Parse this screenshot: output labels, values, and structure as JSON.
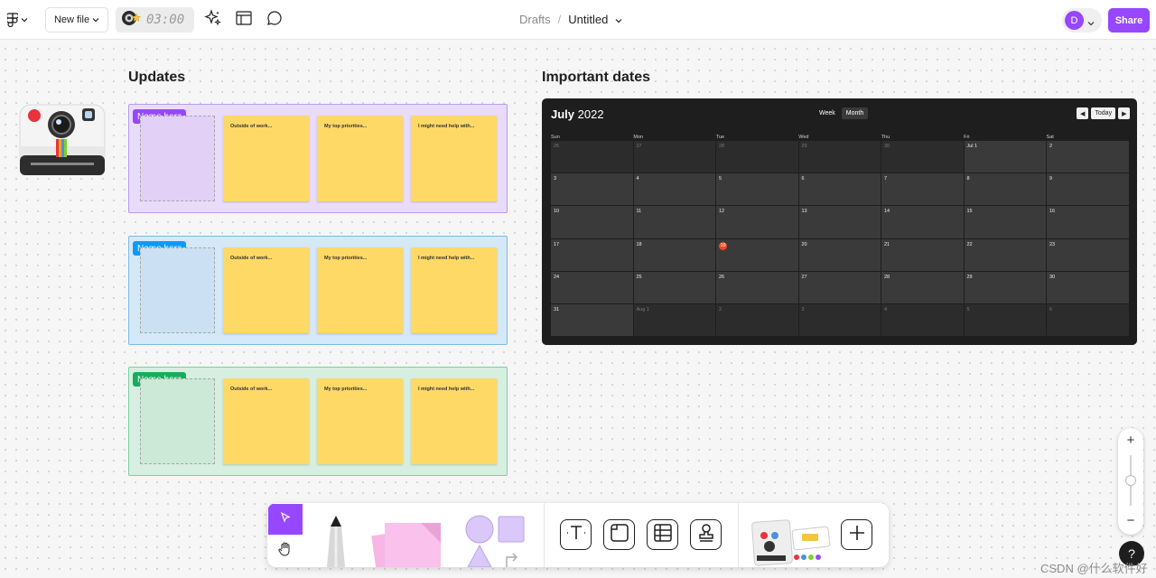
{
  "topbar": {
    "new_file_label": "New file",
    "timer_value": "03:00",
    "breadcrumb_parent": "Drafts",
    "breadcrumb_separator": "/",
    "file_title": "Untitled",
    "avatar_initial": "D",
    "share_label": "Share"
  },
  "updates": {
    "title": "Updates",
    "rows": [
      {
        "tag": "Name here",
        "color": "#9747ff",
        "notes": [
          "Outside of work...",
          "My top priorities...",
          "I might need help with..."
        ]
      },
      {
        "tag": "Name here",
        "color": "#0d99ff",
        "notes": [
          "Outside of work...",
          "My top priorities...",
          "I might need help with..."
        ]
      },
      {
        "tag": "Name here",
        "color": "#14ae5c",
        "notes": [
          "Outside of work...",
          "My top priorities...",
          "I might need help with..."
        ]
      }
    ]
  },
  "calendar": {
    "section_title": "Important dates",
    "month": "July",
    "year": "2022",
    "view_week": "Week",
    "view_month": "Month",
    "nav_today": "Today",
    "nav_prev": "◀",
    "nav_next": "▶",
    "weekdays": [
      "Sun",
      "Mon",
      "Tue",
      "Wed",
      "Thu",
      "Fri",
      "Sat"
    ],
    "weeks": [
      [
        "26",
        "27",
        "28",
        "29",
        "30",
        "Jul 1",
        "2"
      ],
      [
        "3",
        "4",
        "5",
        "6",
        "7",
        "8",
        "9"
      ],
      [
        "10",
        "11",
        "12",
        "13",
        "14",
        "15",
        "16"
      ],
      [
        "17",
        "18",
        "19",
        "20",
        "21",
        "22",
        "23"
      ],
      [
        "24",
        "25",
        "26",
        "27",
        "28",
        "29",
        "30"
      ],
      [
        "31",
        "Aug 1",
        "2",
        "3",
        "4",
        "5",
        "6"
      ]
    ],
    "today": "19"
  },
  "zoom": {
    "plus": "+",
    "minus": "−",
    "level": 0.5
  },
  "help": {
    "label": "?"
  },
  "watermark": "CSDN @什么软件好",
  "colors": {
    "accent": "#9747ff",
    "sticky": "#ffd966",
    "calendar_bg": "#1e1e1e",
    "today": "#f24822"
  },
  "toolbar": {
    "tools": [
      "select-tool",
      "hand-tool",
      "marker-tool",
      "sticky-note-tool",
      "shape-tool",
      "text-tool",
      "section-tool",
      "table-tool",
      "stamp-tool",
      "widgets-tool",
      "add-tool"
    ]
  }
}
